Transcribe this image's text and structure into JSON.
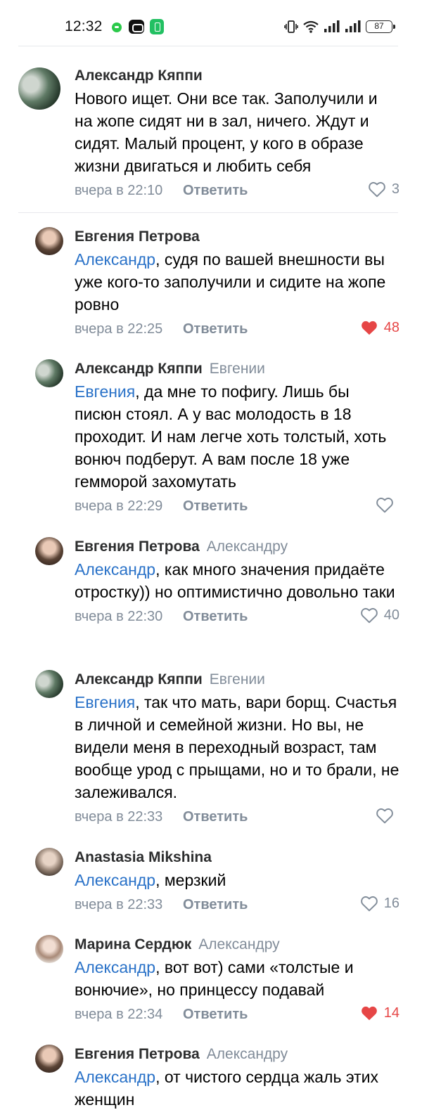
{
  "status_bar": {
    "time": "12:32",
    "battery": "87",
    "icons": [
      "messages-app-icon",
      "app-icon",
      "battery-saver-icon",
      "vibrate-icon",
      "wifi-icon",
      "signal-icon",
      "signal-icon"
    ]
  },
  "colors": {
    "accent": "#2a72c8",
    "liked": "#e64646",
    "secondary": "#818c99"
  },
  "comments": [
    {
      "author": "Александр Кяппи",
      "reply_to": "",
      "mention": "",
      "text": "Нового ищет. Они все так. Заполучили и на жопе сидят ни в зал, ничего. Ждут и сидят. Малый процент, у кого в образе жизни двигаться и любить себя",
      "time": "вчера в 22:10",
      "reply_label": "Ответить",
      "likes": "3",
      "liked": false
    },
    {
      "author": "Евгения Петрова",
      "reply_to": "",
      "mention": "Александр",
      "text": ", судя по вашей внешности вы уже кого-то заполучили и сидите на жопе ровно",
      "time": "вчера в 22:25",
      "reply_label": "Ответить",
      "likes": "48",
      "liked": true
    },
    {
      "author": "Александр Кяппи",
      "reply_to": "Евгении",
      "mention": "Евгения",
      "text": ", да мне то пофигу. Лишь бы писюн стоял. А у вас молодость в 18 проходит. И нам легче хоть толстый, хоть вонюч подберут. А вам после 18 уже гемморой захомутать",
      "time": "вчера в 22:29",
      "reply_label": "Ответить",
      "likes": "",
      "liked": false
    },
    {
      "author": "Евгения Петрова",
      "reply_to": "Александру",
      "mention": "Александр",
      "text": ", как много значения придаёте отростку)) но оптимистично довольно таки",
      "time": "вчера в 22:30",
      "reply_label": "Ответить",
      "likes": "40",
      "liked": false
    },
    {
      "author": "Александр Кяппи",
      "reply_to": "Евгении",
      "mention": "Евгения",
      "text": ", так что мать, вари борщ. Счастья в личной и семейной жизни. Но вы, не видели меня в переходный возраст, там вообще урод с прыщами, но и то брали, не залеживался.",
      "time": "вчера в 22:33",
      "reply_label": "Ответить",
      "likes": "",
      "liked": false
    },
    {
      "author": "Anastasia Mikshina",
      "reply_to": "",
      "mention": "Александр",
      "text": ", мерзкий",
      "time": "вчера в 22:33",
      "reply_label": "Ответить",
      "likes": "16",
      "liked": false
    },
    {
      "author": "Марина Сердюк",
      "reply_to": "Александру",
      "mention": "Александр",
      "text": ", вот вот) сами «толстые и вонючие», но принцессу подавай",
      "time": "вчера в 22:34",
      "reply_label": "Ответить",
      "likes": "14",
      "liked": true
    },
    {
      "author": "Евгения Петрова",
      "reply_to": "Александру",
      "mention": "Александр",
      "text": ", от чистого сердца жаль этих женщин",
      "time": "",
      "reply_label": "",
      "likes": "",
      "liked": false
    }
  ]
}
